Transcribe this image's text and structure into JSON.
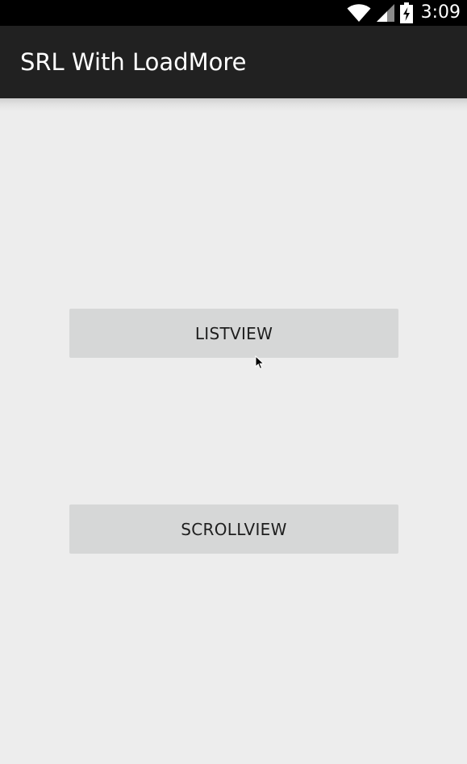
{
  "status_bar": {
    "time": "3:09",
    "icons": [
      "wifi-icon",
      "cell-signal-icon",
      "battery-charging-icon"
    ]
  },
  "action_bar": {
    "title": "SRL With LoadMore"
  },
  "buttons": {
    "listview_label": "LISTVIEW",
    "scrollview_label": "SCROLLVIEW"
  },
  "colors": {
    "status_bar": "#000000",
    "action_bar": "#212121",
    "background": "#ededed",
    "button": "#d6d7d7"
  }
}
